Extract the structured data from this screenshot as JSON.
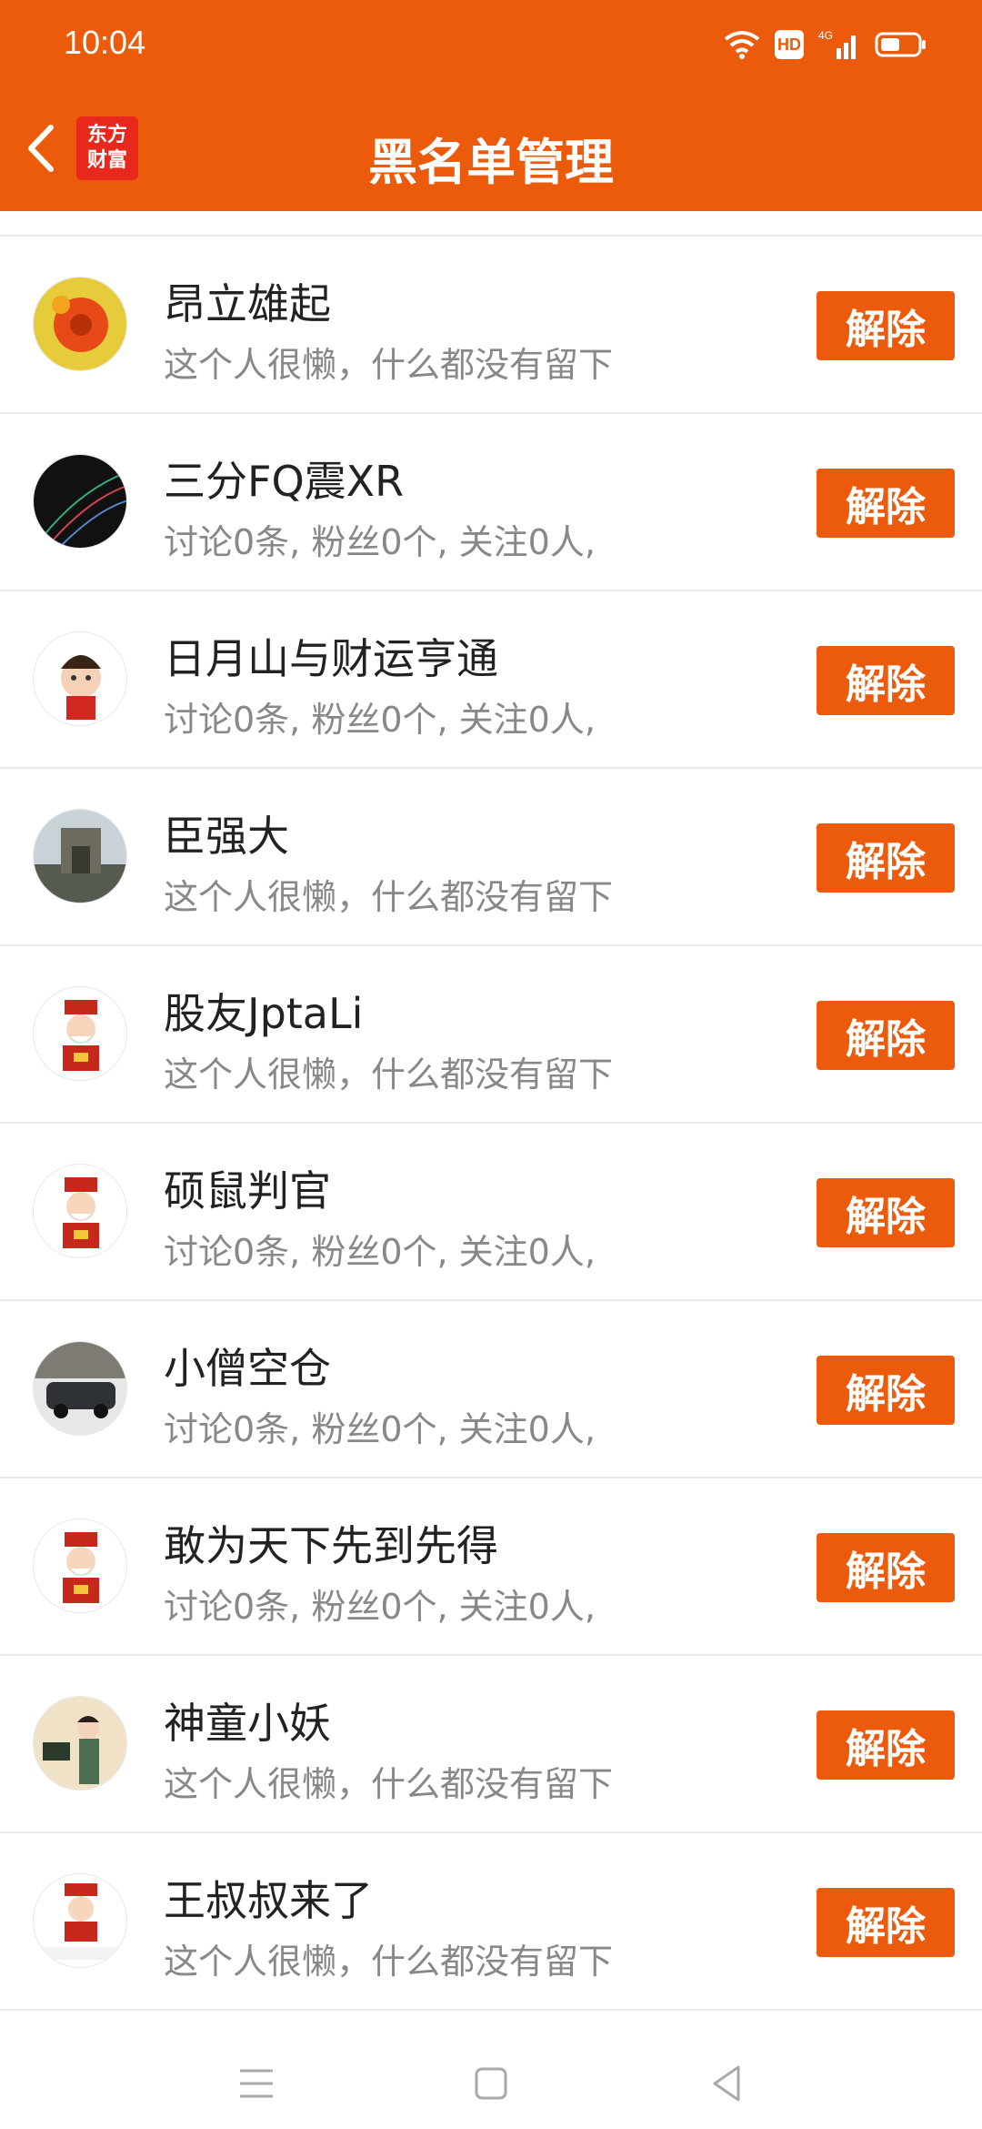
{
  "status": {
    "time": "10:04",
    "network": "4G",
    "hd": "HD"
  },
  "header": {
    "title": "黑名单管理",
    "logo_line1": "东方",
    "logo_line2": "财富"
  },
  "button_label": "解除",
  "colors": {
    "accent": "#EB5B0B",
    "text": "#222222",
    "muted": "#888888"
  },
  "users": [
    {
      "name": "昂立雄起",
      "desc": "这个人很懒，什么都没有留下",
      "avatar": "flower"
    },
    {
      "name": "三分FQ震XR",
      "desc": "讨论0条, 粉丝0个, 关注0人,",
      "avatar": "dark-lines"
    },
    {
      "name": "日月山与财运亨通",
      "desc": "讨论0条, 粉丝0个, 关注0人,",
      "avatar": "cartoon-girl"
    },
    {
      "name": "臣强大",
      "desc": "这个人很懒，什么都没有留下",
      "avatar": "great-wall"
    },
    {
      "name": "股友JptaLi",
      "desc": "这个人很懒，什么都没有留下",
      "avatar": "fortune-god"
    },
    {
      "name": "硕鼠判官",
      "desc": "讨论0条, 粉丝0个, 关注0人,",
      "avatar": "fortune-god"
    },
    {
      "name": "小僧空仓",
      "desc": "讨论0条, 粉丝0个, 关注0人,",
      "avatar": "car"
    },
    {
      "name": "敢为天下先到先得",
      "desc": "讨论0条, 粉丝0个, 关注0人,",
      "avatar": "fortune-god"
    },
    {
      "name": "神童小妖",
      "desc": "这个人很懒，什么都没有留下",
      "avatar": "lady"
    },
    {
      "name": "王叔叔来了",
      "desc": "这个人很懒，什么都没有留下",
      "avatar": "fortune-god-pending"
    }
  ]
}
